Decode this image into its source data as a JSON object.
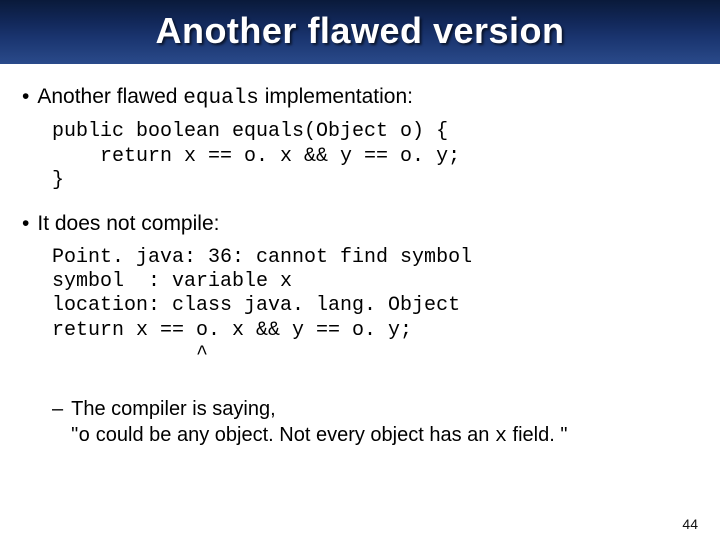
{
  "title": "Another flawed version",
  "bullet1": {
    "pre": "Another flawed ",
    "code": "equals",
    "post": " implementation:"
  },
  "code1": "public boolean equals(Object o) {\n    return x == o. x && y == o. y;\n}",
  "bullet2": "It does not compile:",
  "code2": "Point. java: 36: cannot find symbol\nsymbol  : variable x\nlocation: class java. lang. Object\nreturn x == o. x && y == o. y;\n            ^",
  "sub": {
    "line1": "The compiler is saying,",
    "quote_open": "\"",
    "code_o": "o",
    "mid": " could be any object. Not every object has an ",
    "code_x": "x",
    "end": " field. \""
  },
  "page": "44"
}
